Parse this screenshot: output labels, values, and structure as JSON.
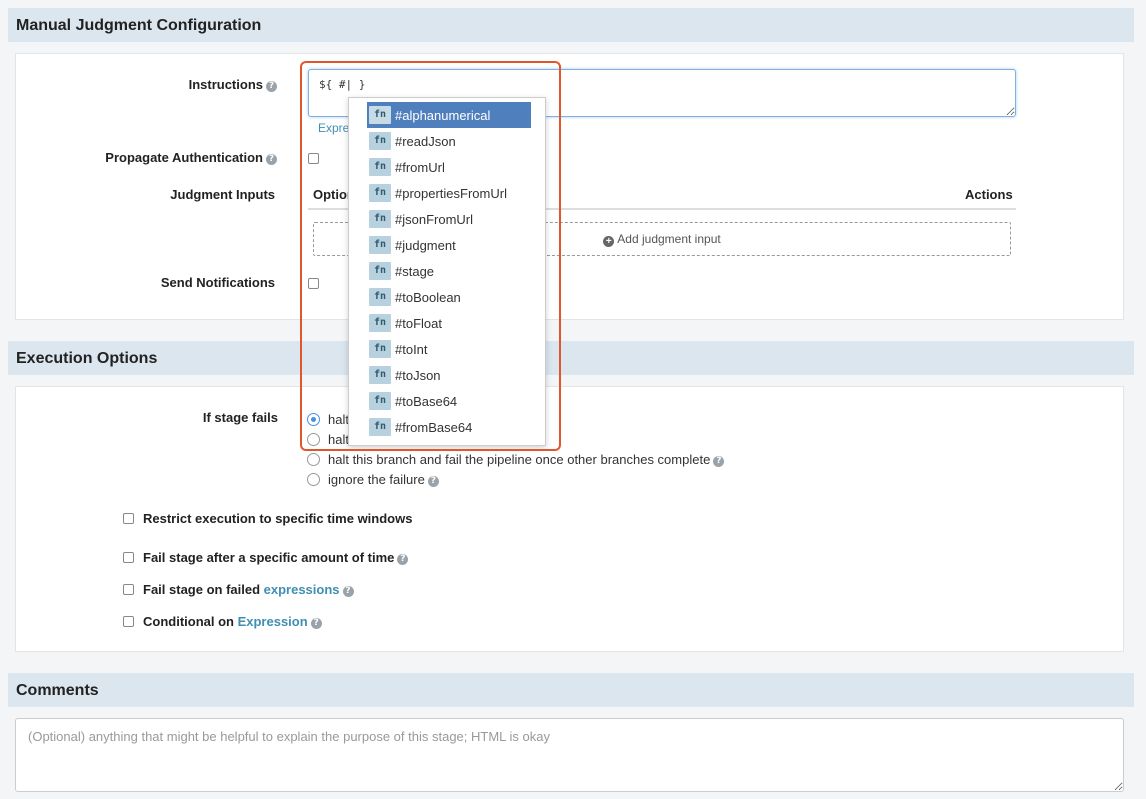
{
  "manual_judgment": {
    "title": "Manual Judgment Configuration",
    "instructions_label": "Instructions",
    "instructions_value": "${ #| }",
    "expression_hint": "Expre",
    "propagate_label": "Propagate Authentication",
    "judgment_inputs_label": "Judgment Inputs",
    "col_options": "Option",
    "col_actions": "Actions",
    "add_input_label": "Add judgment input",
    "send_notifications_label": "Send Notifications"
  },
  "autocomplete": {
    "items": [
      "#alphanumerical",
      "#readJson",
      "#fromUrl",
      "#propertiesFromUrl",
      "#jsonFromUrl",
      "#judgment",
      "#stage",
      "#toBoolean",
      "#toFloat",
      "#toInt",
      "#toJson",
      "#toBase64",
      "#fromBase64"
    ],
    "badge": "fn",
    "active_index": 0
  },
  "execution": {
    "title": "Execution Options",
    "if_stage_fails_label": "If stage fails",
    "radio_options": [
      "halt",
      "halt",
      "halt this branch and fail the pipeline once other branches complete",
      "ignore the failure"
    ],
    "selected_radio": 0,
    "restrict_label": "Restrict execution to specific time windows",
    "fail_after_label": "Fail stage after a specific amount of time",
    "fail_on_prefix": "Fail stage on failed ",
    "fail_on_link": "expressions",
    "conditional_prefix": "Conditional on ",
    "conditional_link": "Expression"
  },
  "comments": {
    "title": "Comments",
    "placeholder": "(Optional) anything that might be helpful to explain the purpose of this stage; HTML is okay"
  },
  "colors": {
    "header_bg": "#dbe6ee",
    "highlight_border": "#e2562b",
    "active_item_bg": "#4f7fbd",
    "link": "#3f8fb4"
  }
}
